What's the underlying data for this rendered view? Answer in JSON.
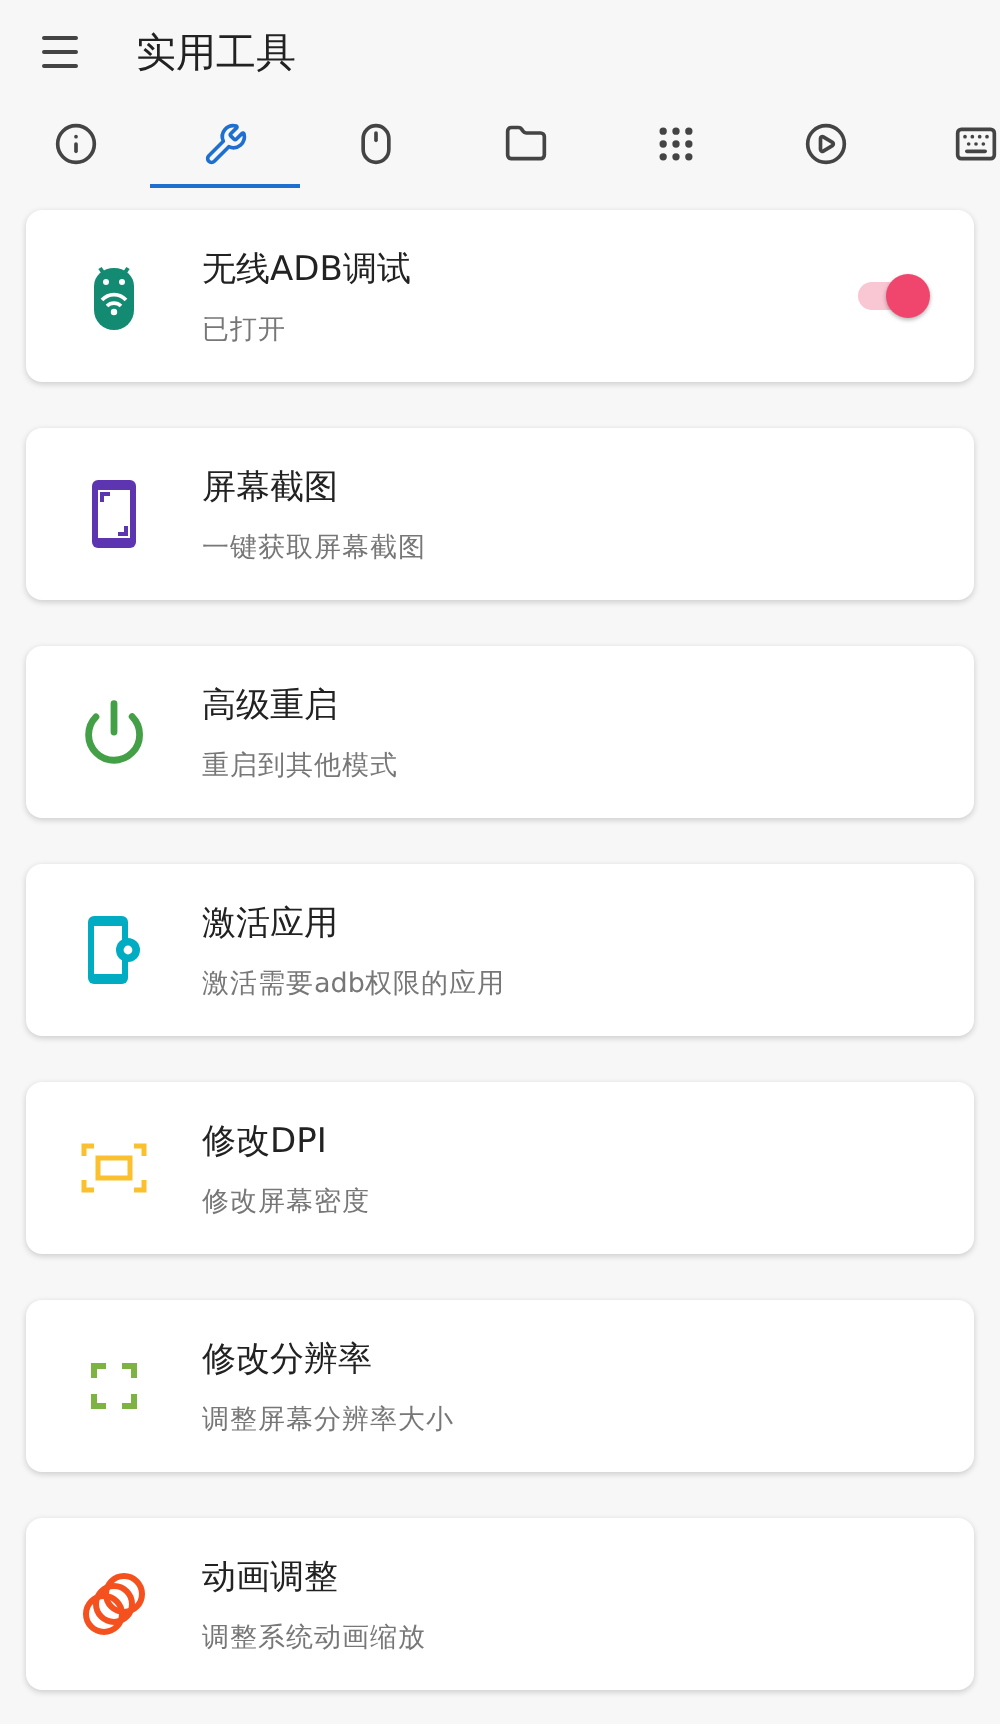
{
  "app_bar": {
    "title": "实用工具"
  },
  "tabs": [
    {
      "selected": false
    },
    {
      "selected": true
    },
    {
      "selected": false
    },
    {
      "selected": false
    },
    {
      "selected": false
    },
    {
      "selected": false
    },
    {
      "selected": false
    }
  ],
  "tools": [
    {
      "kind": "switch",
      "title": "无线ADB调试",
      "subtitle": "已打开",
      "on": true
    },
    {
      "kind": "plain",
      "title": "屏幕截图",
      "subtitle": "一键获取屏幕截图"
    },
    {
      "kind": "plain",
      "title": "高级重启",
      "subtitle": "重启到其他模式"
    },
    {
      "kind": "plain",
      "title": "激活应用",
      "subtitle": "激活需要adb权限的应用"
    },
    {
      "kind": "plain",
      "title": "修改DPI",
      "subtitle": "修改屏幕密度"
    },
    {
      "kind": "plain",
      "title": "修改分辨率",
      "subtitle": "调整屏幕分辨率大小"
    },
    {
      "kind": "plain",
      "title": "动画调整",
      "subtitle": "调整系统动画缩放"
    }
  ]
}
